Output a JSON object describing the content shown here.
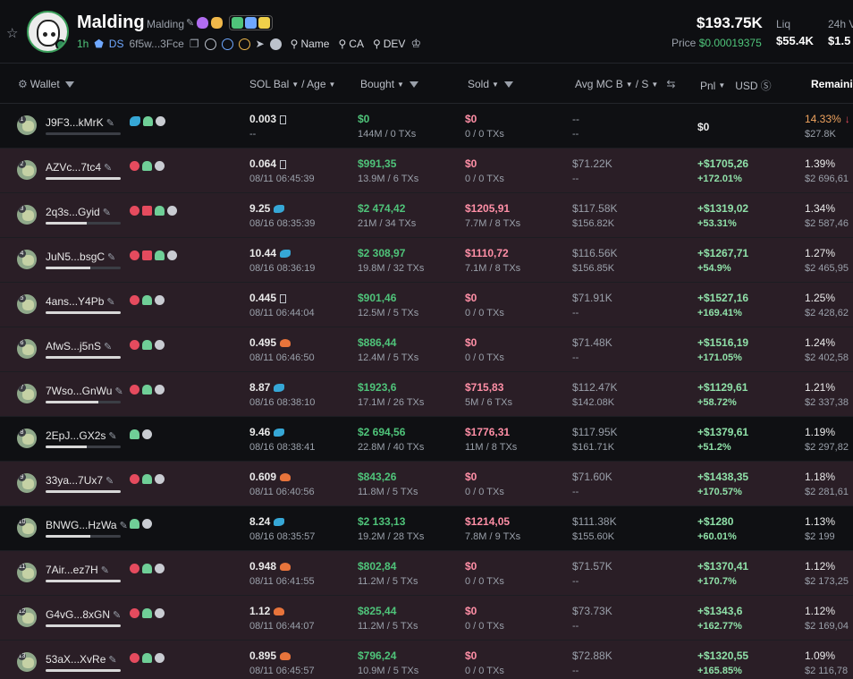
{
  "token": {
    "name": "Malding",
    "sub": "Malding",
    "age": "1h",
    "ds": "DS",
    "address": "6f5w...3Fce",
    "search_name": "Name",
    "search_ca": "CA",
    "search_dev": "DEV",
    "price_main": "$193.75K",
    "price_label": "Price",
    "price_val": "$0.00019375",
    "liq_label": "Liq",
    "liq_val": "$55.4K",
    "vol_label": "24h V",
    "vol_val": "$1.5"
  },
  "columns": {
    "wallet": "Wallet",
    "solbal": "SOL Bal",
    "age": "/ Age",
    "bought": "Bought",
    "sold": "Sold",
    "avgmc": "Avg MC B",
    "s": "/ S",
    "pnl": "Pnl",
    "usd": "USD",
    "remaining": "Remainin"
  },
  "rows": [
    {
      "rank": "1",
      "name": "J9F3...kMrK",
      "bar": 0.0,
      "flags": [
        "person-fish",
        "person",
        "list"
      ],
      "sol": "0.003",
      "solicon": "box",
      "age": "--",
      "bought": "$0",
      "bought_sub": "144M / 0 TXs",
      "sold": "$0",
      "sold_sub": "0 / 0 TXs",
      "avgb": "--",
      "avgs": "--",
      "pnl": "$0",
      "pnl_pct": "",
      "remain": "14.33%",
      "remain_sub": "$27.8K",
      "style": "dark",
      "pnl_white": true,
      "remain_orange": true
    },
    {
      "rank": "2",
      "name": "AZVc...7tc4",
      "bar": 1.0,
      "flags": [
        "red",
        "person",
        "list"
      ],
      "sol": "0.064",
      "solicon": "box",
      "age": "08/11 06:45:39",
      "bought": "$991,35",
      "bought_sub": "13.9M / 6 TXs",
      "sold": "$0",
      "sold_sub": "0 / 0 TXs",
      "avgb": "$71.22K",
      "avgs": "--",
      "pnl": "+$1705,26",
      "pnl_pct": "+172.01%",
      "remain": "1.39%",
      "remain_sub": "$2 696,61",
      "style": "pink"
    },
    {
      "rank": "3",
      "name": "2q3s...Gyid",
      "bar": 0.55,
      "flags": [
        "red",
        "pinkstack",
        "person",
        "list"
      ],
      "sol": "9.25",
      "solicon": "fish",
      "age": "08/16 08:35:39",
      "bought": "$2 474,42",
      "bought_sub": "21M / 34 TXs",
      "sold": "$1205,91",
      "sold_sub": "7.7M / 8 TXs",
      "avgb": "$117.58K",
      "avgs": "$156.82K",
      "pnl": "+$1319,02",
      "pnl_pct": "+53.31%",
      "remain": "1.34%",
      "remain_sub": "$2 587,46",
      "style": "pink"
    },
    {
      "rank": "4",
      "name": "JuN5...bsgC",
      "bar": 0.6,
      "flags": [
        "red",
        "pinkstack",
        "person",
        "list"
      ],
      "sol": "10.44",
      "solicon": "fish",
      "age": "08/16 08:36:19",
      "bought": "$2 308,97",
      "bought_sub": "19.8M / 32 TXs",
      "sold": "$1110,72",
      "sold_sub": "7.1M / 8 TXs",
      "avgb": "$116.56K",
      "avgs": "$156.85K",
      "pnl": "+$1267,71",
      "pnl_pct": "+54.9%",
      "remain": "1.27%",
      "remain_sub": "$2 465,95",
      "style": "pink"
    },
    {
      "rank": "5",
      "name": "4ans...Y4Pb",
      "bar": 1.0,
      "flags": [
        "red",
        "person",
        "list"
      ],
      "sol": "0.445",
      "solicon": "box",
      "age": "08/11 06:44:04",
      "bought": "$901,46",
      "bought_sub": "12.5M / 5 TXs",
      "sold": "$0",
      "sold_sub": "0 / 0 TXs",
      "avgb": "$71.91K",
      "avgs": "--",
      "pnl": "+$1527,16",
      "pnl_pct": "+169.41%",
      "remain": "1.25%",
      "remain_sub": "$2 428,62",
      "style": "pink"
    },
    {
      "rank": "6",
      "name": "AfwS...j5nS",
      "bar": 1.0,
      "flags": [
        "red",
        "person",
        "list"
      ],
      "sol": "0.495",
      "solicon": "shrimp",
      "age": "08/11 06:46:50",
      "bought": "$886,44",
      "bought_sub": "12.4M / 5 TXs",
      "sold": "$0",
      "sold_sub": "0 / 0 TXs",
      "avgb": "$71.48K",
      "avgs": "--",
      "pnl": "+$1516,19",
      "pnl_pct": "+171.05%",
      "remain": "1.24%",
      "remain_sub": "$2 402,58",
      "style": "pink"
    },
    {
      "rank": "7",
      "name": "7Wso...GnWu",
      "bar": 0.7,
      "flags": [
        "red",
        "person",
        "list"
      ],
      "sol": "8.87",
      "solicon": "fish",
      "age": "08/16 08:38:10",
      "bought": "$1923,6",
      "bought_sub": "17.1M / 26 TXs",
      "sold": "$715,83",
      "sold_sub": "5M / 6 TXs",
      "avgb": "$112.47K",
      "avgs": "$142.08K",
      "pnl": "+$1129,61",
      "pnl_pct": "+58.72%",
      "remain": "1.21%",
      "remain_sub": "$2 337,38",
      "style": "pink"
    },
    {
      "rank": "8",
      "name": "2EpJ...GX2s",
      "bar": 0.55,
      "flags": [
        "person",
        "list"
      ],
      "sol": "9.46",
      "solicon": "fish",
      "age": "08/16 08:38:41",
      "bought": "$2 694,56",
      "bought_sub": "22.8M / 40 TXs",
      "sold": "$1776,31",
      "sold_sub": "11M / 8 TXs",
      "avgb": "$117.95K",
      "avgs": "$161.71K",
      "pnl": "+$1379,61",
      "pnl_pct": "+51.2%",
      "remain": "1.19%",
      "remain_sub": "$2 297,82",
      "style": "dark"
    },
    {
      "rank": "9",
      "name": "33ya...7Ux7",
      "bar": 1.0,
      "flags": [
        "red",
        "person",
        "list"
      ],
      "sol": "0.609",
      "solicon": "shrimp",
      "age": "08/11 06:40:56",
      "bought": "$843,26",
      "bought_sub": "11.8M / 5 TXs",
      "sold": "$0",
      "sold_sub": "0 / 0 TXs",
      "avgb": "$71.60K",
      "avgs": "--",
      "pnl": "+$1438,35",
      "pnl_pct": "+170.57%",
      "remain": "1.18%",
      "remain_sub": "$2 281,61",
      "style": "pink"
    },
    {
      "rank": "10",
      "name": "BNWG...HzWa",
      "bar": 0.6,
      "flags": [
        "person",
        "list"
      ],
      "sol": "8.24",
      "solicon": "fish",
      "age": "08/16 08:35:57",
      "bought": "$2 133,13",
      "bought_sub": "19.2M / 28 TXs",
      "sold": "$1214,05",
      "sold_sub": "7.8M / 9 TXs",
      "avgb": "$111.38K",
      "avgs": "$155.60K",
      "pnl": "+$1280",
      "pnl_pct": "+60.01%",
      "remain": "1.13%",
      "remain_sub": "$2 199",
      "style": "dark"
    },
    {
      "rank": "11",
      "name": "7Air...ez7H",
      "bar": 1.0,
      "flags": [
        "red",
        "person",
        "list"
      ],
      "sol": "0.948",
      "solicon": "shrimp",
      "age": "08/11 06:41:55",
      "bought": "$802,84",
      "bought_sub": "11.2M / 5 TXs",
      "sold": "$0",
      "sold_sub": "0 / 0 TXs",
      "avgb": "$71.57K",
      "avgs": "--",
      "pnl": "+$1370,41",
      "pnl_pct": "+170.7%",
      "remain": "1.12%",
      "remain_sub": "$2 173,25",
      "style": "pink"
    },
    {
      "rank": "12",
      "name": "G4vG...8xGN",
      "bar": 1.0,
      "flags": [
        "red",
        "person",
        "list"
      ],
      "sol": "1.12",
      "solicon": "shrimp",
      "age": "08/11 06:44:07",
      "bought": "$825,44",
      "bought_sub": "11.2M / 5 TXs",
      "sold": "$0",
      "sold_sub": "0 / 0 TXs",
      "avgb": "$73.73K",
      "avgs": "--",
      "pnl": "+$1343,6",
      "pnl_pct": "+162.77%",
      "remain": "1.12%",
      "remain_sub": "$2 169,04",
      "style": "pink"
    },
    {
      "rank": "13",
      "name": "53aX...XvRe",
      "bar": 1.0,
      "flags": [
        "red",
        "person",
        "list"
      ],
      "sol": "0.895",
      "solicon": "shrimp",
      "age": "08/11 06:45:57",
      "bought": "$796,24",
      "bought_sub": "10.9M / 5 TXs",
      "sold": "$0",
      "sold_sub": "0 / 0 TXs",
      "avgb": "$72.88K",
      "avgs": "--",
      "pnl": "+$1320,55",
      "pnl_pct": "+165.85%",
      "remain": "1.09%",
      "remain_sub": "$2 116,78",
      "style": "pink"
    }
  ]
}
